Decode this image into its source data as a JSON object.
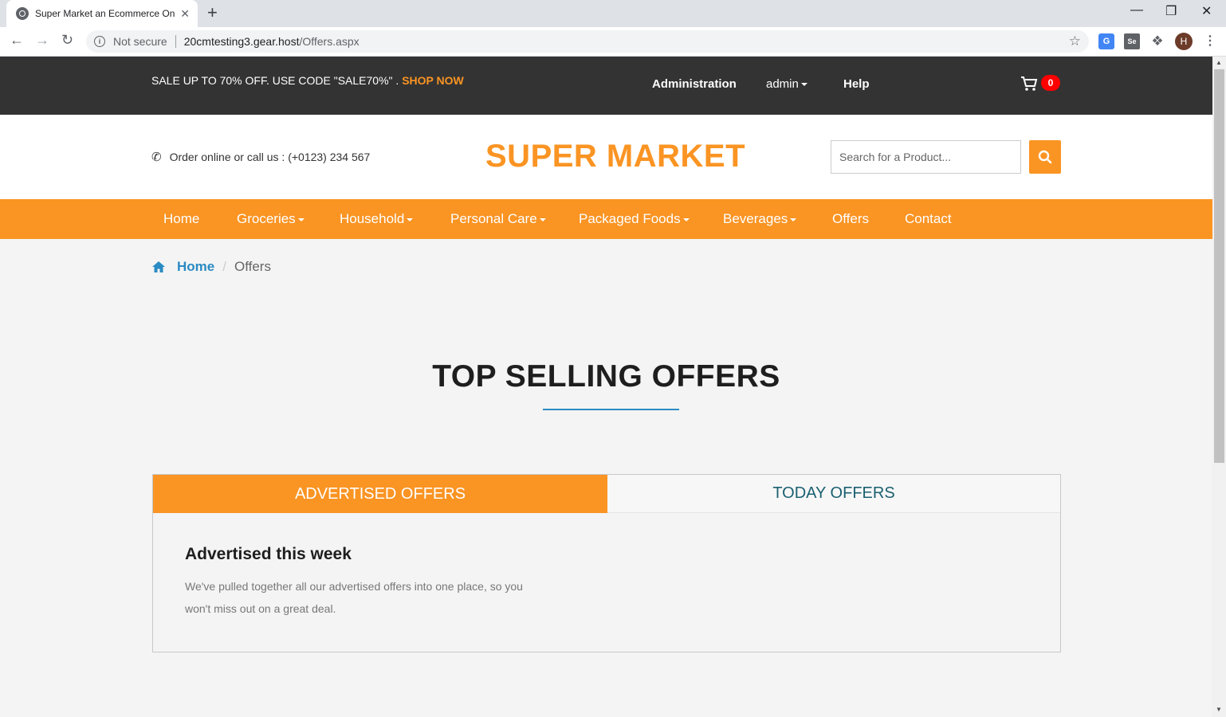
{
  "browser": {
    "tab_title": "Super Market an Ecommerce Onl",
    "tab_close": "✕",
    "new_tab": "+",
    "security_label": "Not secure",
    "url_host": "20cmtesting3.gear.host",
    "url_path": "/Offers.aspx",
    "profile_initial": "H",
    "ext_translate_label": "G",
    "ext_se_label": "Se"
  },
  "topbar": {
    "promo_text": "SALE UP TO 70% OFF. USE CODE \"SALE70%\" .",
    "promo_link": "SHOP NOW",
    "nav_administration": "Administration",
    "nav_admin": "admin",
    "nav_help": "Help",
    "cart_count": "0"
  },
  "header": {
    "phone_text": "Order online or call us : (+0123) 234 567",
    "logo": "SUPER MARKET",
    "search_placeholder": "Search for a Product..."
  },
  "mainnav": {
    "items": [
      "Home",
      "Groceries",
      "Household",
      "Personal Care",
      "Packaged Foods",
      "Beverages",
      "Offers",
      "Contact"
    ]
  },
  "breadcrumb": {
    "home": "Home",
    "current": "Offers"
  },
  "content": {
    "section_title": "TOP SELLING OFFERS",
    "tab_advertised": "ADVERTISED OFFERS",
    "tab_today": "TODAY OFFERS",
    "panel_heading": "Advertised this week",
    "panel_text": "We've pulled together all our advertised offers into one place, so you won't miss out on a great deal."
  },
  "colors": {
    "accent": "#fa9423",
    "topbar": "#333333",
    "link": "#2a8bc4",
    "tab_today_text": "#1b6070"
  },
  "icons": [
    "globe-icon",
    "close-icon",
    "back-icon",
    "forward-icon",
    "reload-icon",
    "info-icon",
    "star-icon",
    "puzzle-icon",
    "menu-icon",
    "cart-icon",
    "phone-icon",
    "search-icon",
    "home-icon"
  ]
}
